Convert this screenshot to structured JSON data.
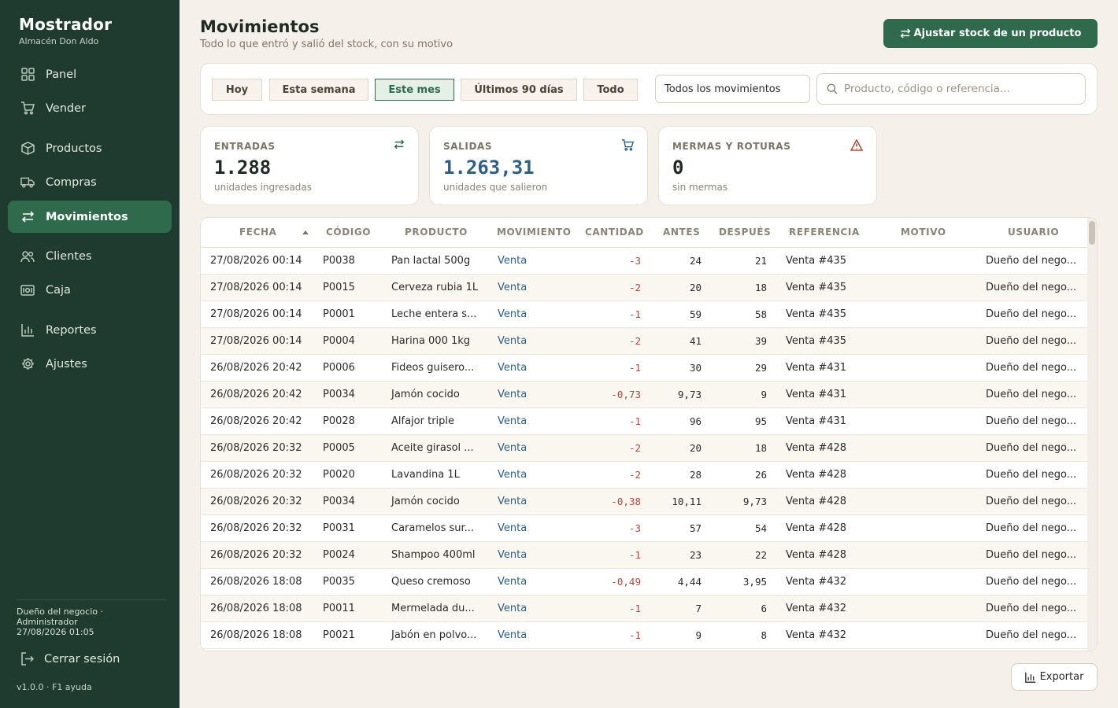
{
  "app": {
    "title": "Mostrador",
    "subtitle": "Almacén Don Aldo"
  },
  "sidebar": {
    "items": [
      {
        "label": "Panel",
        "icon": "grid-icon"
      },
      {
        "label": "Vender",
        "icon": "cart-icon"
      },
      {
        "label": "Productos",
        "icon": "box-icon"
      },
      {
        "label": "Compras",
        "icon": "truck-icon"
      },
      {
        "label": "Movimientos",
        "icon": "arrows-icon",
        "active": true
      },
      {
        "label": "Clientes",
        "icon": "users-icon"
      },
      {
        "label": "Caja",
        "icon": "cash-icon"
      },
      {
        "label": "Reportes",
        "icon": "bar-chart-icon"
      },
      {
        "label": "Ajustes",
        "icon": "gear-icon"
      }
    ],
    "user_line1": "Dueño del negocio  ·",
    "user_line2": "Administrador",
    "user_line3": "27/08/2026  01:05",
    "logout": "Cerrar sesión",
    "version": "v1.0.0  ·  F1 ayuda"
  },
  "header": {
    "title": "Movimientos",
    "subtitle": "Todo lo que entró y salió del stock, con su motivo",
    "primary_button": "Ajustar stock de un producto"
  },
  "filters": {
    "chips": [
      "Hoy",
      "Esta semana",
      "Este mes",
      "Últimos 90 días",
      "Todo"
    ],
    "active_chip": "Este mes",
    "type_select": "Todos los movimientos",
    "search_placeholder": "Producto, código o referencia..."
  },
  "stats": [
    {
      "label": "ENTRADAS",
      "value": "1.288",
      "note": "unidades ingresadas",
      "icon": "arrows-icon",
      "color": "#2f6a4c"
    },
    {
      "label": "SALIDAS",
      "value": "1.263,31",
      "note": "unidades que salieron",
      "icon": "cart-icon",
      "color": "#2e5f86"
    },
    {
      "label": "MERMAS Y ROTURAS",
      "value": "0",
      "note": "sin mermas",
      "icon": "warning-icon",
      "color": "#b04a3a"
    }
  ],
  "table": {
    "columns": [
      "FECHA",
      "CÓDIGO",
      "PRODUCTO",
      "MOVIMIENTO",
      "CANTIDAD",
      "ANTES",
      "DESPUÉS",
      "REFERENCIA",
      "MOTIVO",
      "USUARIO"
    ],
    "rows": [
      [
        "27/08/2026 00:14",
        "P0038",
        "Pan lactal 500g",
        "Venta",
        "-3",
        "24",
        "21",
        "Venta #435",
        "",
        "Dueño del nego..."
      ],
      [
        "27/08/2026 00:14",
        "P0015",
        "Cerveza rubia 1L",
        "Venta",
        "-2",
        "20",
        "18",
        "Venta #435",
        "",
        "Dueño del nego..."
      ],
      [
        "27/08/2026 00:14",
        "P0001",
        "Leche entera s...",
        "Venta",
        "-1",
        "59",
        "58",
        "Venta #435",
        "",
        "Dueño del nego..."
      ],
      [
        "27/08/2026 00:14",
        "P0004",
        "Harina 000 1kg",
        "Venta",
        "-2",
        "41",
        "39",
        "Venta #435",
        "",
        "Dueño del nego..."
      ],
      [
        "26/08/2026 20:42",
        "P0006",
        "Fideos guisero...",
        "Venta",
        "-1",
        "30",
        "29",
        "Venta #431",
        "",
        "Dueño del nego..."
      ],
      [
        "26/08/2026 20:42",
        "P0034",
        "Jamón cocido",
        "Venta",
        "-0,73",
        "9,73",
        "9",
        "Venta #431",
        "",
        "Dueño del nego..."
      ],
      [
        "26/08/2026 20:42",
        "P0028",
        "Alfajor triple",
        "Venta",
        "-1",
        "96",
        "95",
        "Venta #431",
        "",
        "Dueño del nego..."
      ],
      [
        "26/08/2026 20:32",
        "P0005",
        "Aceite girasol ...",
        "Venta",
        "-2",
        "20",
        "18",
        "Venta #428",
        "",
        "Dueño del nego..."
      ],
      [
        "26/08/2026 20:32",
        "P0020",
        "Lavandina 1L",
        "Venta",
        "-2",
        "28",
        "26",
        "Venta #428",
        "",
        "Dueño del nego..."
      ],
      [
        "26/08/2026 20:32",
        "P0034",
        "Jamón cocido",
        "Venta",
        "-0,38",
        "10,11",
        "9,73",
        "Venta #428",
        "",
        "Dueño del nego..."
      ],
      [
        "26/08/2026 20:32",
        "P0031",
        "Caramelos sur...",
        "Venta",
        "-3",
        "57",
        "54",
        "Venta #428",
        "",
        "Dueño del nego..."
      ],
      [
        "26/08/2026 20:32",
        "P0024",
        "Shampoo 400ml",
        "Venta",
        "-1",
        "23",
        "22",
        "Venta #428",
        "",
        "Dueño del nego..."
      ],
      [
        "26/08/2026 18:08",
        "P0035",
        "Queso cremoso",
        "Venta",
        "-0,49",
        "4,44",
        "3,95",
        "Venta #432",
        "",
        "Dueño del nego..."
      ],
      [
        "26/08/2026 18:08",
        "P0011",
        "Mermelada du...",
        "Venta",
        "-1",
        "7",
        "6",
        "Venta #432",
        "",
        "Dueño del nego..."
      ],
      [
        "26/08/2026 18:08",
        "P0021",
        "Jabón en polvo...",
        "Venta",
        "-1",
        "9",
        "8",
        "Venta #432",
        "",
        "Dueño del nego..."
      ]
    ]
  },
  "footer": {
    "export_label": "Exportar"
  },
  "colors": {
    "sidebar_bg": "#1f3a2e",
    "accent": "#2f6a4c",
    "link": "#2e5f86",
    "negative": "#b04a3a",
    "page_bg": "#f5f1ea"
  }
}
